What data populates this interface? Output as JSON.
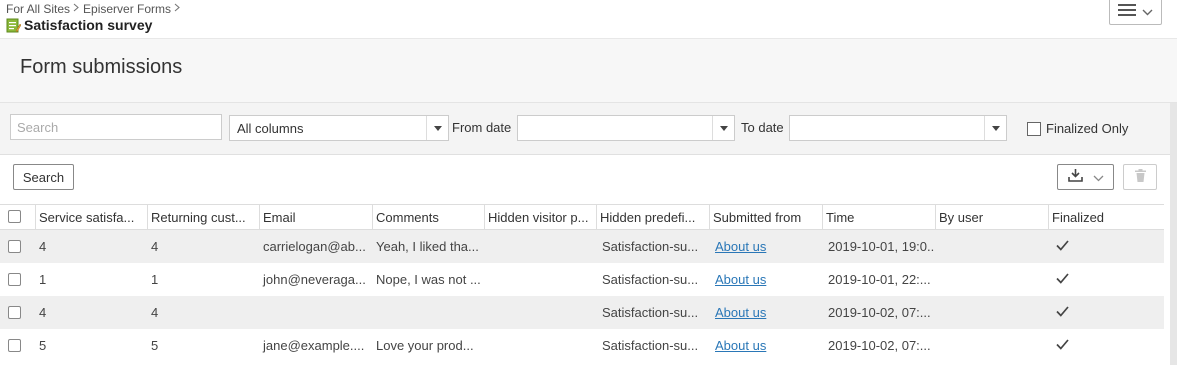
{
  "breadcrumb": {
    "items": [
      "For All Sites",
      "Episerver Forms"
    ]
  },
  "header": {
    "title": "Satisfaction survey"
  },
  "page": {
    "heading": "Form submissions"
  },
  "filters": {
    "search_placeholder": "Search",
    "column_select": "All columns",
    "from_date_label": "From date",
    "from_date_value": "",
    "to_date_label": "To date",
    "to_date_value": "",
    "finalized_only_label": "Finalized Only",
    "finalized_only_checked": false
  },
  "toolbar": {
    "search_label": "Search"
  },
  "table": {
    "columns": [
      "Service satisfa...",
      "Returning cust...",
      "Email",
      "Comments",
      "Hidden visitor p...",
      "Hidden predefi...",
      "Submitted from",
      "Time",
      "By user",
      "Finalized"
    ],
    "rows": [
      {
        "service": "4",
        "returning": "4",
        "email": "carrielogan@ab...",
        "comments": "Yeah, I liked tha...",
        "hidden_visitor": "",
        "hidden_predef": "Satisfaction-su...",
        "submitted_from": "About us",
        "time": "2019-10-01, 19:0...",
        "by_user": "",
        "finalized": true
      },
      {
        "service": "1",
        "returning": "1",
        "email": "john@neveraga...",
        "comments": "Nope, I was not ...",
        "hidden_visitor": "",
        "hidden_predef": "Satisfaction-su...",
        "submitted_from": "About us",
        "time": "2019-10-01, 22:...",
        "by_user": "",
        "finalized": true
      },
      {
        "service": "4",
        "returning": "4",
        "email": "",
        "comments": "",
        "hidden_visitor": "",
        "hidden_predef": "Satisfaction-su...",
        "submitted_from": "About us",
        "time": "2019-10-02, 07:...",
        "by_user": "",
        "finalized": true
      },
      {
        "service": "5",
        "returning": "5",
        "email": "jane@example....",
        "comments": "Love your prod...",
        "hidden_visitor": "",
        "hidden_predef": "Satisfaction-su...",
        "submitted_from": "About us",
        "time": "2019-10-02, 07:...",
        "by_user": "",
        "finalized": true
      }
    ]
  },
  "colors": {
    "link": "#2a77b7",
    "row_alt": "#efefef",
    "icon_green": "#6a9a1f"
  },
  "icons": [
    "chevron-right-icon",
    "form-icon",
    "hamburger-menu-icon",
    "chevron-down-icon",
    "download-icon",
    "trash-icon",
    "checkmark-icon"
  ]
}
